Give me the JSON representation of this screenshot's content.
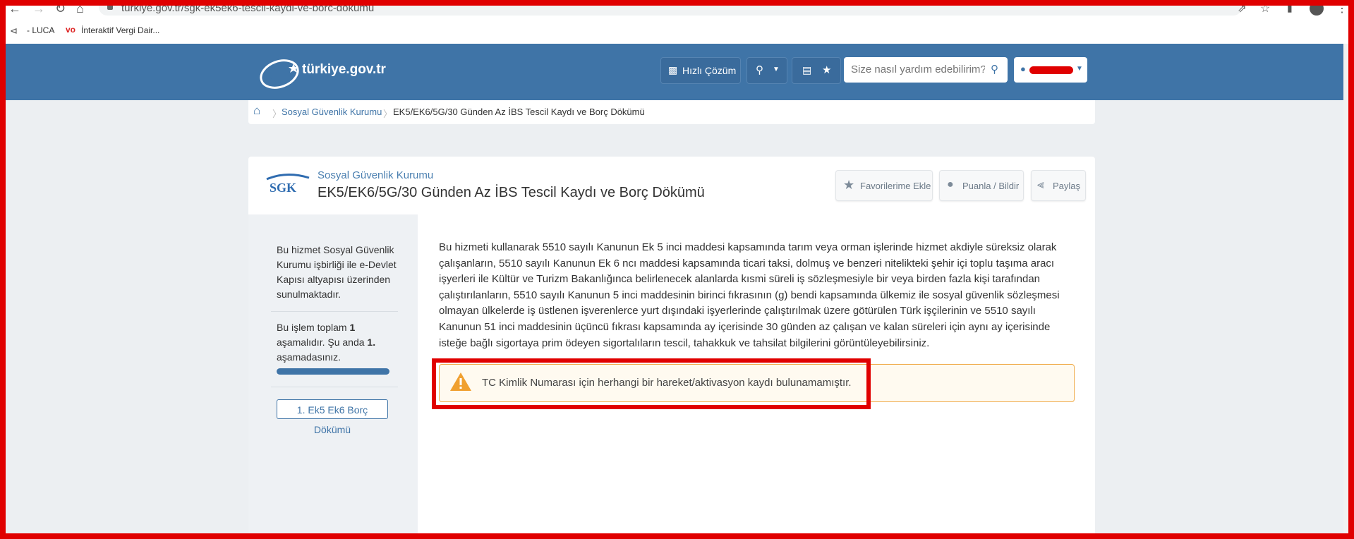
{
  "browser": {
    "url": "turkiye.gov.tr/sgk-ek5ek6-tescil-kaydi-ve-borc-dokumu",
    "bookmarks": [
      "- LUCA",
      "İnteraktif Vergi Dair..."
    ]
  },
  "header": {
    "logo": "türkiye.gov.tr",
    "quick_solution": "Hızlı Çözüm",
    "search_placeholder": "Size nasıl yardım edebilirim?"
  },
  "breadcrumb": {
    "items": [
      "Sosyal Güvenlik Kurumu",
      "EK5/EK6/5G/30 Günden Az İBS Tescil Kaydı ve Borç Dökümü"
    ]
  },
  "service": {
    "institution_logo": "SGK",
    "institution": "Sosyal Güvenlik Kurumu",
    "title": "EK5/EK6/5G/30 Günden Az İBS Tescil Kaydı ve Borç Dökümü",
    "actions": [
      "Favorilerime Ekle",
      "Puanla / Bildir",
      "Paylaş"
    ]
  },
  "sidebar": {
    "provider_note": "Bu hizmet Sosyal Güvenlik Kurumu işbirliği ile e-Devlet Kapısı altyapısı üzerinden sunulmaktadır.",
    "steps_a": "Bu işlem toplam ",
    "steps_total": "1",
    "steps_b": " aşamalıdır. Şu anda ",
    "steps_current": "1.",
    "steps_c": " aşamadasınız.",
    "progress": 1.0,
    "step_button": "1. Ek5 Ek6 Borç Dökümü"
  },
  "content": {
    "description": "Bu hizmeti kullanarak 5510 sayılı Kanunun Ek 5 inci maddesi kapsamında tarım veya orman işlerinde hizmet akdiyle süreksiz olarak çalışanların, 5510 sayılı Kanunun Ek 6 ncı maddesi kapsamında ticari taksi, dolmuş ve benzeri nitelikteki şehir içi toplu taşıma aracı işyerleri ile Kültür ve Turizm Bakanlığınca belirlenecek alanlarda kısmi süreli iş sözleşmesiyle bir veya birden fazla kişi tarafından çalıştırılanların, 5510 sayılı Kanunun 5 inci maddesinin birinci fıkrasının (g) bendi kapsamında ülkemiz ile sosyal güvenlik sözleşmesi olmayan ülkelerde iş üstlenen işverenlerce yurt dışındaki işyerlerinde çalıştırılmak üzere götürülen Türk işçilerinin ve 5510 sayılı Kanunun 51 inci maddesinin üçüncü fıkrası kapsamında ay içerisinde 30 günden az çalışan ve kalan süreleri için aynı ay içerisinde isteğe bağlı sigortaya prim ödeyen sigortalıların tescil, tahakkuk ve tahsilat bilgilerini görüntüleyebilirsiniz.",
    "alert": "TC Kimlik Numarası için herhangi bir hareket/aktivasyon kaydı bulunamamıştır."
  },
  "colors": {
    "header_blue": "#3f74a7",
    "alert_border": "#f0ad4e",
    "annotation_red": "#e00000"
  }
}
